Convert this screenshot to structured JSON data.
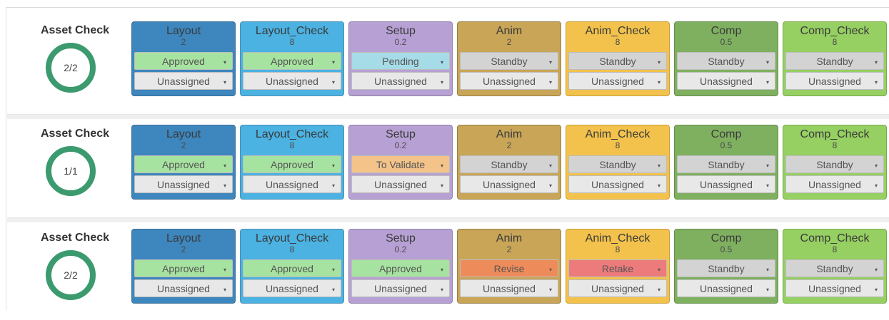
{
  "colors": {
    "ring": "#3c9a6f",
    "status": {
      "Approved": "#a7e3a0",
      "Pending": "#a6dbe8",
      "Standby": "#d3d3d3",
      "To Validate": "#f3c38a",
      "Revise": "#ee8b5a",
      "Retake": "#ee7b7b"
    }
  },
  "rows": [
    {
      "title": "Asset Check",
      "progress": "2/2",
      "cards": [
        {
          "name": "Layout",
          "num": "2",
          "status": "Approved",
          "assign": "Unassigned",
          "cls": "c-layout"
        },
        {
          "name": "Layout_Check",
          "num": "8",
          "status": "Approved",
          "assign": "Unassigned",
          "cls": "c-layoutcheck"
        },
        {
          "name": "Setup",
          "num": "0.2",
          "status": "Pending",
          "assign": "Unassigned",
          "cls": "c-setup"
        },
        {
          "name": "Anim",
          "num": "2",
          "status": "Standby",
          "assign": "Unassigned",
          "cls": "c-anim"
        },
        {
          "name": "Anim_Check",
          "num": "8",
          "status": "Standby",
          "assign": "Unassigned",
          "cls": "c-animcheck"
        },
        {
          "name": "Comp",
          "num": "0.5",
          "status": "Standby",
          "assign": "Unassigned",
          "cls": "c-comp"
        },
        {
          "name": "Comp_Check",
          "num": "8",
          "status": "Standby",
          "assign": "Unassigned",
          "cls": "c-compcheck"
        }
      ]
    },
    {
      "title": "Asset Check",
      "progress": "1/1",
      "cards": [
        {
          "name": "Layout",
          "num": "2",
          "status": "Approved",
          "assign": "Unassigned",
          "cls": "c-layout"
        },
        {
          "name": "Layout_Check",
          "num": "8",
          "status": "Approved",
          "assign": "Unassigned",
          "cls": "c-layoutcheck"
        },
        {
          "name": "Setup",
          "num": "0.2",
          "status": "To Validate",
          "assign": "Unassigned",
          "cls": "c-setup"
        },
        {
          "name": "Anim",
          "num": "2",
          "status": "Standby",
          "assign": "Unassigned",
          "cls": "c-anim"
        },
        {
          "name": "Anim_Check",
          "num": "8",
          "status": "Standby",
          "assign": "Unassigned",
          "cls": "c-animcheck"
        },
        {
          "name": "Comp",
          "num": "0.5",
          "status": "Standby",
          "assign": "Unassigned",
          "cls": "c-comp"
        },
        {
          "name": "Comp_Check",
          "num": "8",
          "status": "Standby",
          "assign": "Unassigned",
          "cls": "c-compcheck"
        }
      ]
    },
    {
      "title": "Asset Check",
      "progress": "2/2",
      "cards": [
        {
          "name": "Layout",
          "num": "2",
          "status": "Approved",
          "assign": "Unassigned",
          "cls": "c-layout"
        },
        {
          "name": "Layout_Check",
          "num": "8",
          "status": "Approved",
          "assign": "Unassigned",
          "cls": "c-layoutcheck"
        },
        {
          "name": "Setup",
          "num": "0.2",
          "status": "Approved",
          "assign": "Unassigned",
          "cls": "c-setup"
        },
        {
          "name": "Anim",
          "num": "2",
          "status": "Revise",
          "assign": "Unassigned",
          "cls": "c-anim"
        },
        {
          "name": "Anim_Check",
          "num": "8",
          "status": "Retake",
          "assign": "Unassigned",
          "cls": "c-animcheck"
        },
        {
          "name": "Comp",
          "num": "0.5",
          "status": "Standby",
          "assign": "Unassigned",
          "cls": "c-comp"
        },
        {
          "name": "Comp_Check",
          "num": "8",
          "status": "Standby",
          "assign": "Unassigned",
          "cls": "c-compcheck"
        }
      ]
    }
  ]
}
